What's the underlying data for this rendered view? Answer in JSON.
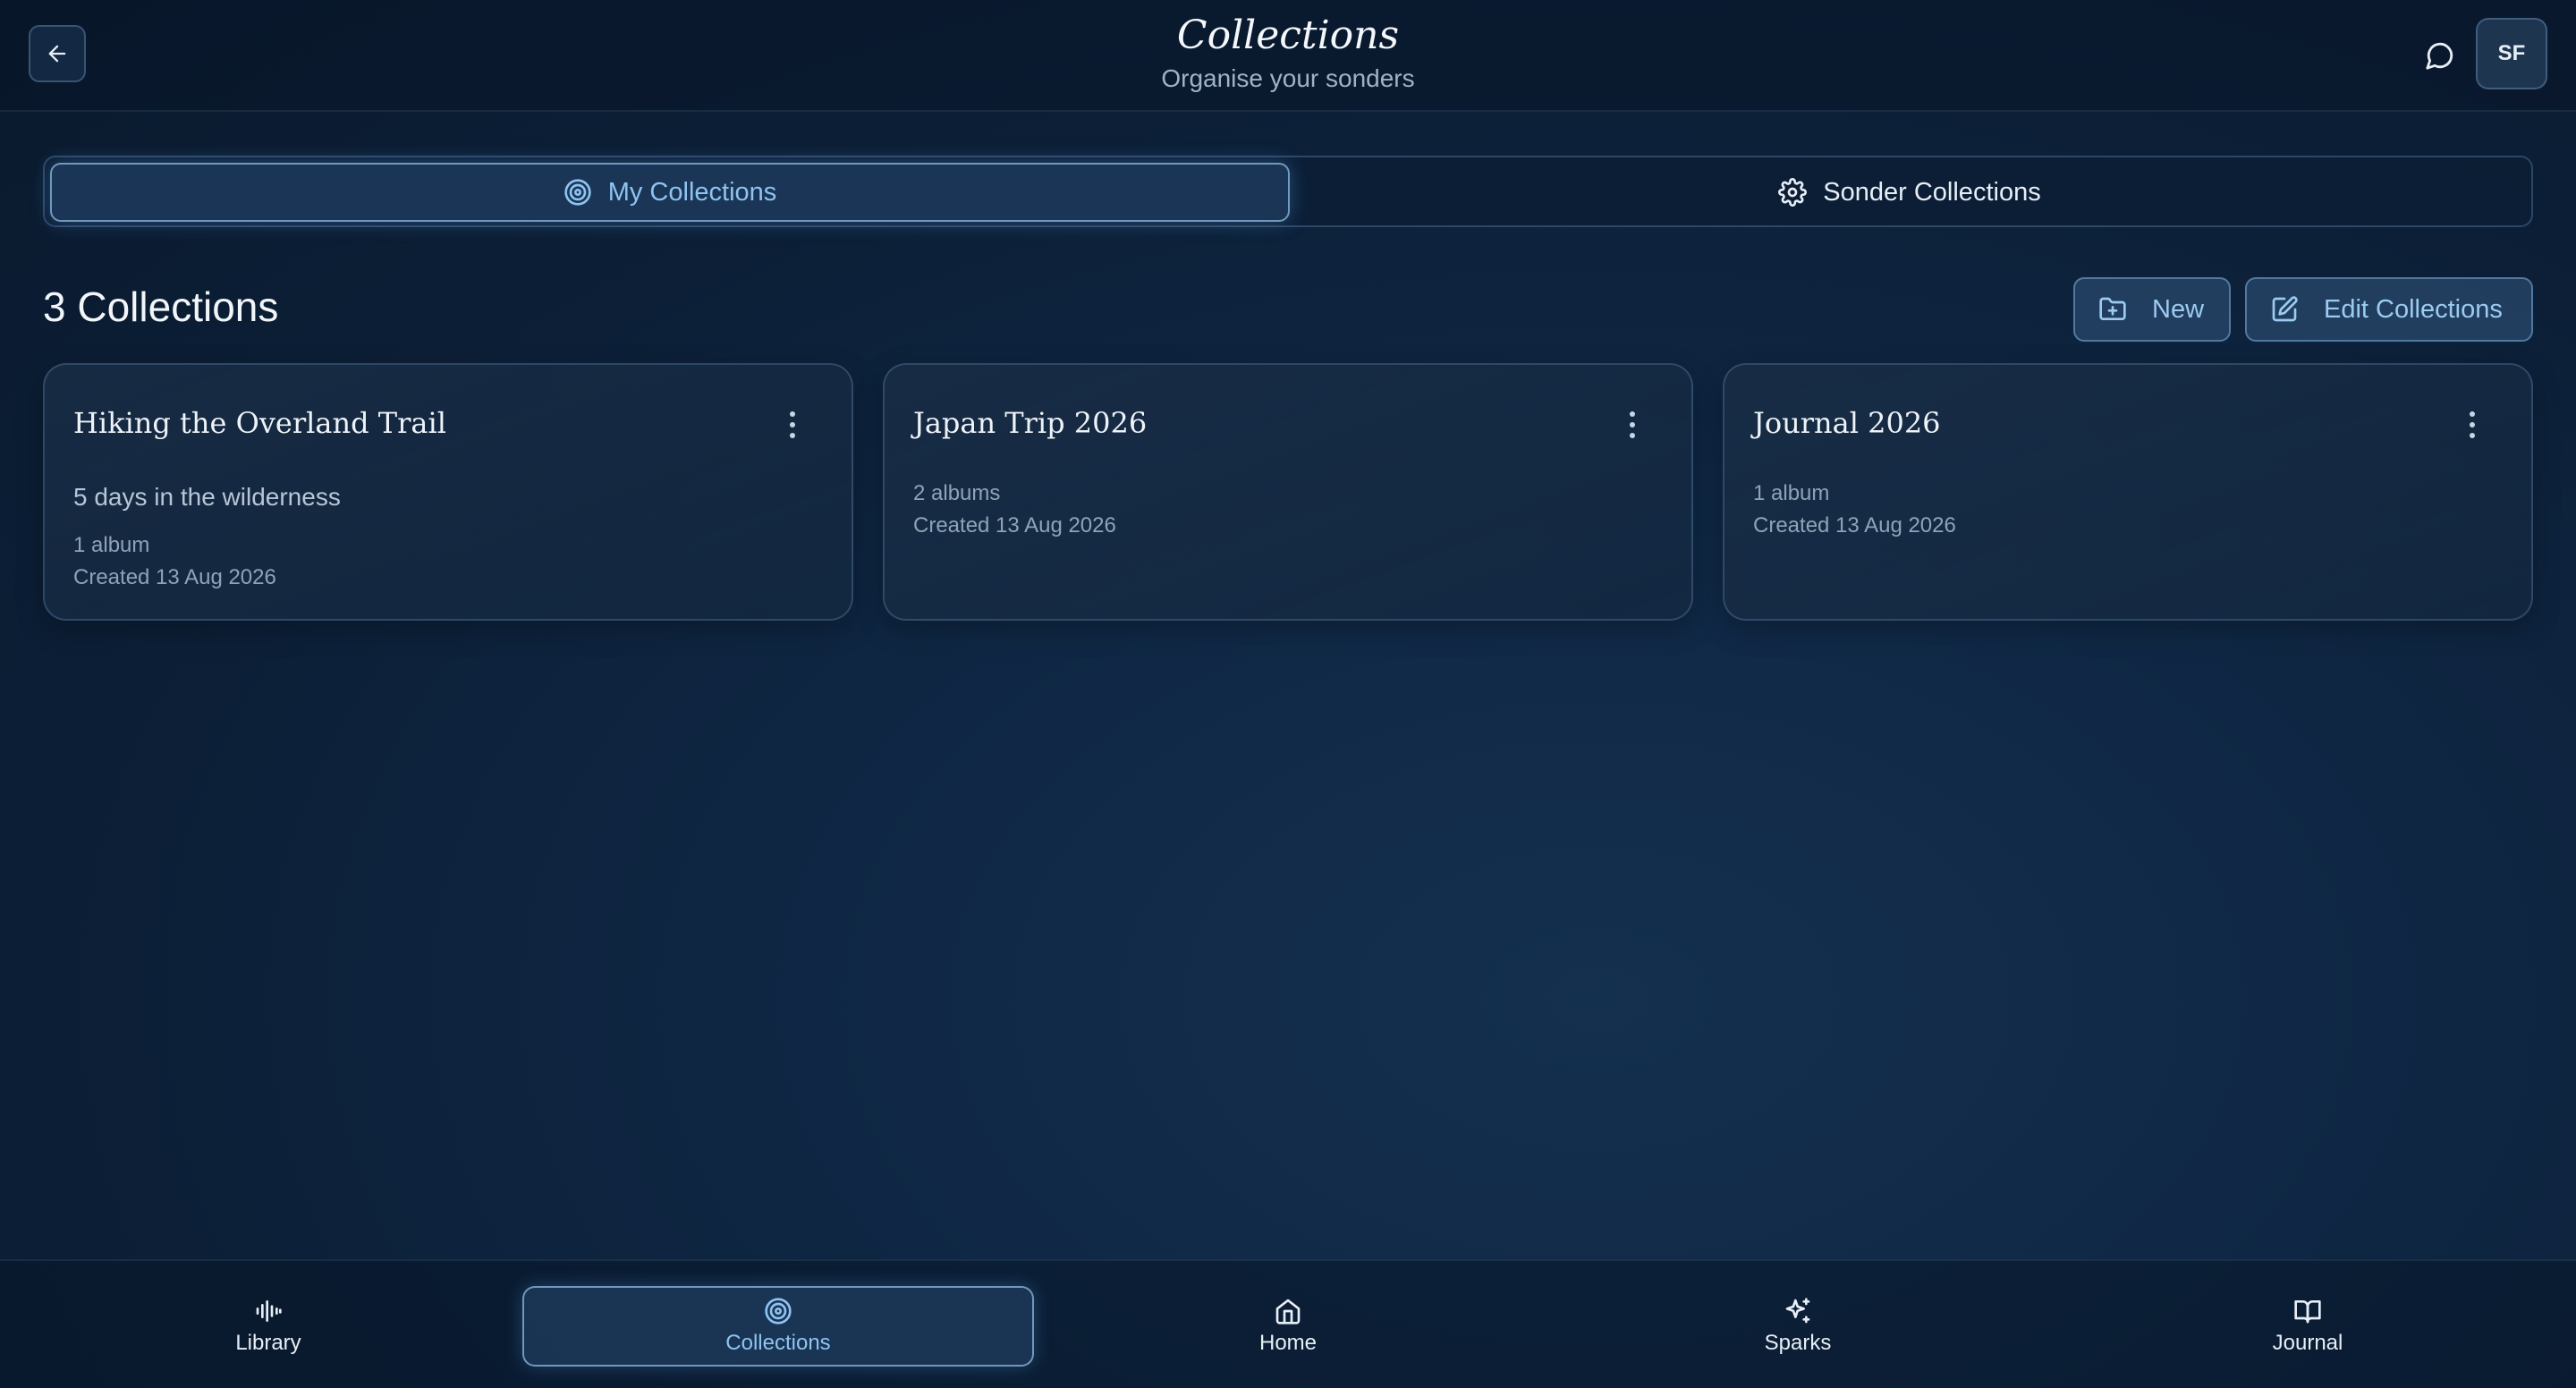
{
  "header": {
    "title": "Collections",
    "subtitle": "Organise your sonders",
    "avatar_initials": "SF",
    "back_icon": "arrow-left-icon",
    "chat_icon": "message-circle-icon"
  },
  "tabs": [
    {
      "label": "My Collections",
      "icon": "target-icon",
      "active": true
    },
    {
      "label": "Sonder Collections",
      "icon": "gear-icon",
      "active": false
    }
  ],
  "section": {
    "count_label": "3 Collections",
    "new_label": "New",
    "edit_label": "Edit Collections"
  },
  "collections": [
    {
      "title": "Hiking the Overland Trail",
      "description": "5 days in the wilderness",
      "albums": "1 album",
      "created": "Created 13 Aug 2026"
    },
    {
      "title": "Japan Trip 2026",
      "description": "",
      "albums": "2 albums",
      "created": "Created 13 Aug 2026"
    },
    {
      "title": "Journal 2026",
      "description": "",
      "albums": "1 album",
      "created": "Created 13 Aug 2026"
    }
  ],
  "nav": [
    {
      "label": "Library",
      "icon": "waveform-icon",
      "active": false
    },
    {
      "label": "Collections",
      "icon": "target-icon",
      "active": true
    },
    {
      "label": "Home",
      "icon": "home-icon",
      "active": false
    },
    {
      "label": "Sparks",
      "icon": "sparkles-icon",
      "active": false
    },
    {
      "label": "Journal",
      "icon": "book-open-icon",
      "active": false
    }
  ],
  "colors": {
    "accent": "#8ec4f0",
    "background": "#0c1f37",
    "card": "#19304a"
  }
}
